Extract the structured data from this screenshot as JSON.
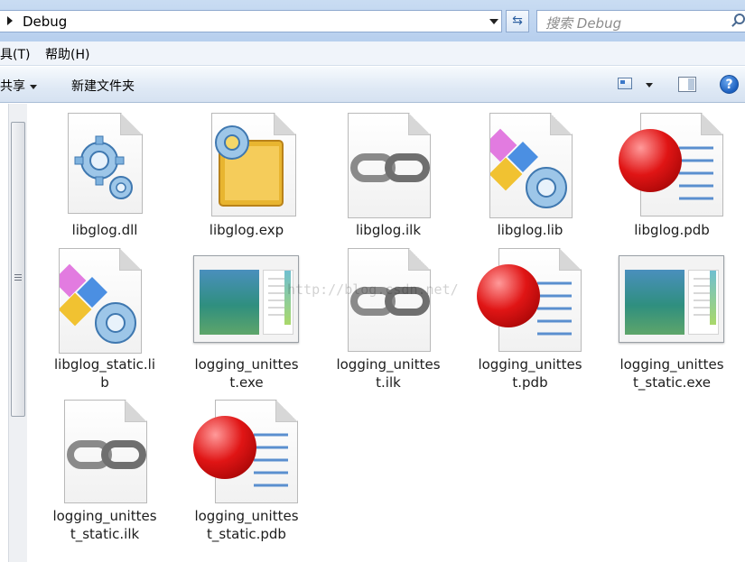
{
  "address_bar": {
    "path": "Debug"
  },
  "search": {
    "placeholder": "搜索 Debug"
  },
  "menu": {
    "tools": "具(T)",
    "help": "帮助(H)"
  },
  "commands": {
    "share": "共享",
    "new_folder": "新建文件夹"
  },
  "help_glyph": "?",
  "watermark": "http://blog.csdn.net/",
  "files": [
    {
      "name": "libglog.dll",
      "icon": "dll-gears-icon"
    },
    {
      "name": "libglog.exp",
      "icon": "exp-book-gear-icon"
    },
    {
      "name": "libglog.ilk",
      "icon": "ilk-chain-icon"
    },
    {
      "name": "libglog.lib",
      "icon": "lib-blocks-gear-icon"
    },
    {
      "name": "libglog.pdb",
      "icon": "pdb-red-ball-icon"
    },
    {
      "name_line1": "libglog_static.li",
      "name_line2": "b",
      "icon": "lib-blocks-gear-icon"
    },
    {
      "name_line1": "logging_unittes",
      "name_line2": "t.exe",
      "icon": "exe-window-icon"
    },
    {
      "name_line1": "logging_unittes",
      "name_line2": "t.ilk",
      "icon": "ilk-chain-icon"
    },
    {
      "name_line1": "logging_unittes",
      "name_line2": "t.pdb",
      "icon": "pdb-red-ball-icon"
    },
    {
      "name_line1": "logging_unittes",
      "name_line2": "t_static.exe",
      "icon": "exe-window-icon"
    },
    {
      "name_line1": "logging_unittes",
      "name_line2": "t_static.ilk",
      "icon": "ilk-chain-icon"
    },
    {
      "name_line1": "logging_unittes",
      "name_line2": "t_static.pdb",
      "icon": "pdb-red-ball-icon"
    }
  ]
}
